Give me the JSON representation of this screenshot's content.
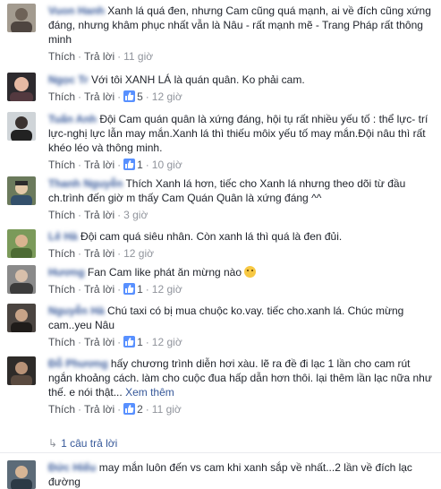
{
  "labels": {
    "like": "Thích",
    "reply": "Trả lời",
    "see_more": "Xem thêm"
  },
  "comments": [
    {
      "name": "Vuon Hanh",
      "text": "Xanh lá quá đen, nhưng Cam cũng quá mạnh, ai về đích cũng xứng đáng, nhưng khâm phục nhất vẫn là Nâu - rất mạnh mẽ - Trang Pháp rất thông minh",
      "likes": "",
      "time": "11 giờ"
    },
    {
      "name": "Ngọc Tr",
      "text": "Với tôi XANH LÁ là quán quân. Ko phải cam.",
      "likes": "5",
      "time": "12 giờ"
    },
    {
      "name": "Tuấn Anh",
      "text": "Đội Cam quán quân là xứng đáng, hội tụ rất nhiều yếu tố : thể lực- trí lực-nghị lực lẫn may mắn.Xanh lá thì thiếu môix yếu tố may mắn.Đội nâu thì rất khéo léo và thông minh.",
      "likes": "1",
      "time": "10 giờ"
    },
    {
      "name": "Thanh Nguyễn",
      "text": "Thích Xanh lá hơn, tiếc cho Xanh lá nhưng theo dõi từ đầu ch.trình đến giờ m thấy Cam Quán Quân là xứng đáng ^^",
      "likes": "",
      "time": "3 giờ"
    },
    {
      "name": "Lê Hà",
      "text": "Đội cam quá siêu nhân. Còn xanh lá thì quá là đen đủi.",
      "likes": "",
      "time": "12 giờ"
    },
    {
      "name": "Hương",
      "text": "Fan Cam like phát ăn mừng nào",
      "likes": "1",
      "time": "12 giờ"
    },
    {
      "name": "Nguyễn Hà",
      "text": "Chú taxi có bị mua chuộc ko.vay. tiếc cho.xanh lá. Chúc mừng cam..yeu Nâu",
      "likes": "1",
      "time": "12 giờ"
    },
    {
      "name": "Đỗ Phương",
      "text": "hấy chương trình diễn hơi xàu. lẽ ra đề đi lạc 1 lần cho cam rút ngắn khoảng cách. làm cho cuộc đua hấp dẫn hơn thôi. lại thêm lần lạc nữa như thế. e nói thật...",
      "likes": "2",
      "time": "11 giờ"
    },
    {
      "name": "Đức Hiếu",
      "text": "may mắn luôn đến vs cam khi xanh sắp về nhất...2 lần về đích lạc đường",
      "likes": "",
      "time": ""
    }
  ],
  "reply_count": "1 câu trả lời"
}
